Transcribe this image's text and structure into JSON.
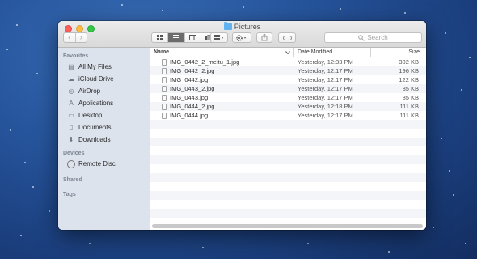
{
  "window": {
    "title": "Pictures"
  },
  "toolbar": {
    "back_icon": "‹",
    "forward_icon": "›",
    "search_placeholder": "Search"
  },
  "sidebar": {
    "favorites_heading": "Favorites",
    "favorites": [
      {
        "label": "All My Files",
        "icon": "all-files-icon"
      },
      {
        "label": "iCloud Drive",
        "icon": "cloud-icon"
      },
      {
        "label": "AirDrop",
        "icon": "airdrop-icon"
      },
      {
        "label": "Applications",
        "icon": "applications-icon"
      },
      {
        "label": "Desktop",
        "icon": "desktop-icon"
      },
      {
        "label": "Documents",
        "icon": "documents-icon"
      },
      {
        "label": "Downloads",
        "icon": "downloads-icon"
      }
    ],
    "devices_heading": "Devices",
    "devices": [
      {
        "label": "Remote Disc",
        "icon": "disc-icon"
      }
    ],
    "shared_heading": "Shared",
    "tags_heading": "Tags"
  },
  "columns": {
    "name": "Name",
    "date": "Date Modified",
    "size": "Size"
  },
  "files": [
    {
      "name": "IMG_0442_2_meitu_1.jpg",
      "date": "Yesterday, 12:33 PM",
      "size": "302 KB"
    },
    {
      "name": "IMG_0442_2.jpg",
      "date": "Yesterday, 12:17 PM",
      "size": "196 KB"
    },
    {
      "name": "IMG_0442.jpg",
      "date": "Yesterday, 12:17 PM",
      "size": "122 KB"
    },
    {
      "name": "IMG_0443_2.jpg",
      "date": "Yesterday, 12:17 PM",
      "size": "85 KB"
    },
    {
      "name": "IMG_0443.jpg",
      "date": "Yesterday, 12:17 PM",
      "size": "85 KB"
    },
    {
      "name": "IMG_0444_2.jpg",
      "date": "Yesterday, 12:18 PM",
      "size": "111 KB"
    },
    {
      "name": "IMG_0444.jpg",
      "date": "Yesterday, 12:17 PM",
      "size": "111 KB"
    }
  ],
  "empty_rows": 11,
  "colors": {
    "sidebar_bg": "#dde3ec",
    "folder": "#5fb3f0",
    "desktop_bg": "#27569e"
  }
}
